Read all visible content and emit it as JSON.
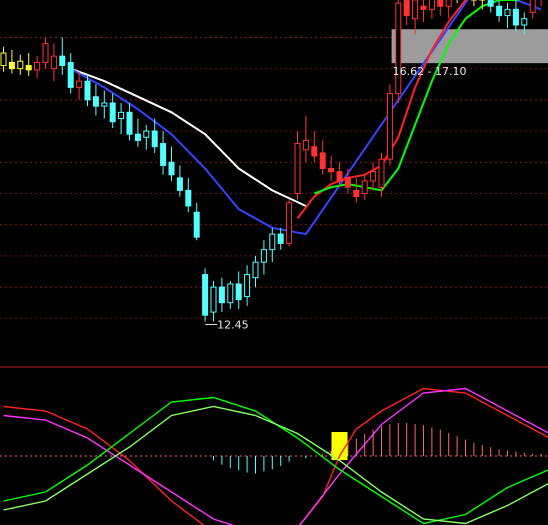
{
  "chart_data": [
    {
      "type": "candlestick",
      "panel": "price",
      "grid": "dotted horizontal red lines",
      "ylim": [
        11.8,
        17.6
      ],
      "annotations": [
        {
          "label": "12.45",
          "type": "low-marker",
          "value": 12.45
        },
        {
          "label": "16.62 - 17.10",
          "type": "price-band",
          "low": 16.62,
          "high": 17.1
        }
      ],
      "candles": [
        {
          "o": 16.55,
          "h": 16.85,
          "l": 16.45,
          "c": 16.75,
          "color": "#ffff33"
        },
        {
          "o": 16.6,
          "h": 16.8,
          "l": 16.42,
          "c": 16.5,
          "color": "#ffff33"
        },
        {
          "o": 16.5,
          "h": 16.72,
          "l": 16.4,
          "c": 16.62,
          "color": "#ffff33"
        },
        {
          "o": 16.55,
          "h": 16.75,
          "l": 16.38,
          "c": 16.48,
          "color": "#ffff33"
        },
        {
          "o": 16.48,
          "h": 16.7,
          "l": 16.35,
          "c": 16.6,
          "color": "#ff3333"
        },
        {
          "o": 16.6,
          "h": 17.0,
          "l": 16.5,
          "c": 16.9,
          "color": "#ff3333"
        },
        {
          "o": 16.5,
          "h": 16.9,
          "l": 16.3,
          "c": 16.7,
          "color": "#ff3333"
        },
        {
          "o": 16.7,
          "h": 17.0,
          "l": 16.4,
          "c": 16.55,
          "color": "#54ffff"
        },
        {
          "o": 16.6,
          "h": 16.75,
          "l": 16.1,
          "c": 16.2,
          "color": "#54ffff"
        },
        {
          "o": 16.2,
          "h": 16.45,
          "l": 16.0,
          "c": 16.3,
          "color": "#ff3333"
        },
        {
          "o": 16.3,
          "h": 16.4,
          "l": 15.9,
          "c": 16.0,
          "color": "#54ffff"
        },
        {
          "o": 16.05,
          "h": 16.25,
          "l": 15.75,
          "c": 15.9,
          "color": "#54ffff"
        },
        {
          "o": 15.9,
          "h": 16.15,
          "l": 15.7,
          "c": 15.95,
          "color": "#54ffff"
        },
        {
          "o": 15.95,
          "h": 16.1,
          "l": 15.55,
          "c": 15.65,
          "color": "#54ffff"
        },
        {
          "o": 15.7,
          "h": 15.95,
          "l": 15.45,
          "c": 15.8,
          "color": "#54ffff"
        },
        {
          "o": 15.8,
          "h": 15.95,
          "l": 15.35,
          "c": 15.45,
          "color": "#54ffff"
        },
        {
          "o": 15.45,
          "h": 15.7,
          "l": 15.25,
          "c": 15.35,
          "color": "#54ffff"
        },
        {
          "o": 15.4,
          "h": 15.6,
          "l": 15.2,
          "c": 15.5,
          "color": "#54ffff"
        },
        {
          "o": 15.5,
          "h": 15.7,
          "l": 15.15,
          "c": 15.25,
          "color": "#54ffff"
        },
        {
          "o": 15.3,
          "h": 15.5,
          "l": 14.8,
          "c": 14.95,
          "color": "#54ffff"
        },
        {
          "o": 15.0,
          "h": 15.25,
          "l": 14.7,
          "c": 14.8,
          "color": "#54ffff"
        },
        {
          "o": 14.75,
          "h": 14.95,
          "l": 14.45,
          "c": 14.55,
          "color": "#54ffff"
        },
        {
          "o": 14.55,
          "h": 14.75,
          "l": 14.2,
          "c": 14.3,
          "color": "#54ffff"
        },
        {
          "o": 14.2,
          "h": 14.35,
          "l": 13.75,
          "c": 13.8,
          "color": "#54ffff"
        },
        {
          "o": 13.2,
          "h": 13.3,
          "l": 12.45,
          "c": 12.55,
          "color": "#54ffff"
        },
        {
          "o": 12.6,
          "h": 13.1,
          "l": 12.45,
          "c": 13.0,
          "color": "#54ffff"
        },
        {
          "o": 13.0,
          "h": 13.15,
          "l": 12.6,
          "c": 12.75,
          "color": "#54ffff"
        },
        {
          "o": 12.75,
          "h": 13.1,
          "l": 12.65,
          "c": 13.05,
          "color": "#54ffff"
        },
        {
          "o": 13.05,
          "h": 13.25,
          "l": 12.65,
          "c": 12.8,
          "color": "#54ffff"
        },
        {
          "o": 12.85,
          "h": 13.35,
          "l": 12.7,
          "c": 13.2,
          "color": "#54ffff"
        },
        {
          "o": 13.15,
          "h": 13.5,
          "l": 13.0,
          "c": 13.4,
          "color": "#54ffff"
        },
        {
          "o": 13.4,
          "h": 13.75,
          "l": 13.2,
          "c": 13.6,
          "color": "#54ffff"
        },
        {
          "o": 13.6,
          "h": 13.95,
          "l": 13.4,
          "c": 13.85,
          "color": "#54ffff"
        },
        {
          "o": 13.85,
          "h": 13.95,
          "l": 13.6,
          "c": 13.7,
          "color": "#54ffff"
        },
        {
          "o": 13.7,
          "h": 14.4,
          "l": 13.65,
          "c": 14.35,
          "color": "#ff3333"
        },
        {
          "o": 14.5,
          "h": 15.5,
          "l": 14.4,
          "c": 15.3,
          "color": "#ff3333"
        },
        {
          "o": 15.2,
          "h": 15.75,
          "l": 15.0,
          "c": 15.35,
          "color": "#ff3333"
        },
        {
          "o": 15.25,
          "h": 15.5,
          "l": 15.0,
          "c": 15.1,
          "color": "#ff3333"
        },
        {
          "o": 15.15,
          "h": 15.35,
          "l": 14.8,
          "c": 14.9,
          "color": "#ff3333"
        },
        {
          "o": 14.9,
          "h": 15.1,
          "l": 14.7,
          "c": 14.85,
          "color": "#ff3333"
        },
        {
          "o": 14.85,
          "h": 15.0,
          "l": 14.6,
          "c": 14.7,
          "color": "#ff3333"
        },
        {
          "o": 14.75,
          "h": 14.9,
          "l": 14.5,
          "c": 14.6,
          "color": "#ff3333"
        },
        {
          "o": 14.55,
          "h": 14.75,
          "l": 14.35,
          "c": 14.45,
          "color": "#ff3333"
        },
        {
          "o": 14.5,
          "h": 14.8,
          "l": 14.4,
          "c": 14.7,
          "color": "#ff3333"
        },
        {
          "o": 14.7,
          "h": 15.0,
          "l": 14.55,
          "c": 14.85,
          "color": "#ff3333"
        },
        {
          "o": 14.6,
          "h": 15.15,
          "l": 14.45,
          "c": 15.05,
          "color": "#ff3333"
        },
        {
          "o": 15.05,
          "h": 16.25,
          "l": 14.95,
          "c": 16.1,
          "color": "#ff3333"
        },
        {
          "o": 16.1,
          "h": 17.7,
          "l": 15.95,
          "c": 17.55,
          "color": "#ff3333"
        },
        {
          "o": 17.6,
          "h": 17.9,
          "l": 17.2,
          "c": 17.35,
          "color": "#ff3333"
        },
        {
          "o": 17.3,
          "h": 17.7,
          "l": 17.05,
          "c": 17.6,
          "color": "#ff3333"
        },
        {
          "o": 17.5,
          "h": 17.8,
          "l": 17.25,
          "c": 17.45,
          "color": "#ff3333"
        },
        {
          "o": 17.45,
          "h": 17.75,
          "l": 17.3,
          "c": 17.65,
          "color": "#ff3333"
        },
        {
          "o": 17.6,
          "h": 17.85,
          "l": 17.35,
          "c": 17.5,
          "color": "#ff3333"
        },
        {
          "o": 17.5,
          "h": 17.8,
          "l": 17.3,
          "c": 17.7,
          "color": "#ff3333"
        },
        {
          "o": 17.7,
          "h": 17.95,
          "l": 17.55,
          "c": 17.85,
          "color": "#ffff33"
        },
        {
          "o": 17.85,
          "h": 17.95,
          "l": 17.6,
          "c": 17.7,
          "color": "#ffff33"
        },
        {
          "o": 17.7,
          "h": 17.9,
          "l": 17.5,
          "c": 17.6,
          "color": "#ffff33"
        },
        {
          "o": 17.6,
          "h": 17.85,
          "l": 17.45,
          "c": 17.75,
          "color": "#ffff33"
        },
        {
          "o": 17.75,
          "h": 17.85,
          "l": 17.4,
          "c": 17.5,
          "color": "#54ffff"
        },
        {
          "o": 17.5,
          "h": 17.65,
          "l": 17.25,
          "c": 17.35,
          "color": "#54ffff"
        },
        {
          "o": 17.35,
          "h": 17.55,
          "l": 17.15,
          "c": 17.45,
          "color": "#54ffff"
        },
        {
          "o": 17.45,
          "h": 17.6,
          "l": 17.1,
          "c": 17.2,
          "color": "#54ffff"
        },
        {
          "o": 17.2,
          "h": 17.4,
          "l": 17.05,
          "c": 17.3,
          "color": "#54ffff"
        },
        {
          "o": 17.4,
          "h": 17.75,
          "l": 17.3,
          "c": 17.65,
          "color": "#ff3333"
        },
        {
          "o": 17.65,
          "h": 17.95,
          "l": 17.5,
          "c": 17.8,
          "color": "#ff3333"
        },
        {
          "o": 17.8,
          "h": 17.95,
          "l": 17.65,
          "c": 17.9,
          "color": "#ffff33"
        }
      ],
      "series": [
        {
          "color": "#ffffff",
          "x": [
            8,
            12,
            16,
            20,
            24,
            28,
            32,
            36
          ],
          "values": [
            16.5,
            16.3,
            16.05,
            15.8,
            15.45,
            14.9,
            14.55,
            14.3
          ]
        },
        {
          "color": "#3344ff",
          "x": [
            8,
            12,
            16,
            20,
            24,
            28,
            32,
            36,
            56,
            58,
            60,
            62,
            64
          ],
          "values": [
            16.5,
            16.2,
            15.85,
            15.45,
            14.9,
            14.25,
            13.95,
            13.85,
            17.75,
            17.72,
            17.65,
            17.55,
            17.45
          ]
        },
        {
          "color": "#ff2222",
          "x": [
            35,
            37,
            39,
            41,
            43,
            45,
            47,
            49,
            51,
            53,
            55,
            57,
            59,
            61,
            63,
            65
          ],
          "values": [
            14.1,
            14.45,
            14.65,
            14.75,
            14.8,
            14.95,
            15.4,
            16.2,
            16.8,
            17.25,
            17.6,
            17.85,
            17.95,
            17.95,
            17.9,
            17.95
          ]
        },
        {
          "color": "#00ff00",
          "x": [
            37,
            39,
            41,
            43,
            45,
            47,
            49,
            51,
            53,
            55,
            57,
            59,
            61,
            63,
            65
          ],
          "values": [
            14.5,
            14.6,
            14.65,
            14.6,
            14.55,
            14.9,
            15.6,
            16.3,
            16.9,
            17.3,
            17.5,
            17.6,
            17.6,
            17.65,
            17.75
          ]
        }
      ]
    },
    {
      "type": "line",
      "panel": "indicator",
      "grid": "dotted zero line",
      "ylim": [
        -1,
        1
      ],
      "highlight": {
        "x": 40,
        "color": "#ffff00"
      },
      "histogram": {
        "x": [
          25,
          26,
          27,
          28,
          29,
          30,
          31,
          32,
          33,
          34,
          36,
          37,
          38,
          39,
          40,
          41,
          42,
          43,
          44,
          45,
          46,
          47,
          48,
          49,
          50,
          51,
          52,
          53,
          54,
          55,
          56,
          57,
          58,
          59,
          60,
          61,
          62,
          63,
          64,
          65
        ],
        "values": [
          -0.04,
          -0.08,
          -0.11,
          -0.13,
          -0.15,
          -0.16,
          -0.14,
          -0.12,
          -0.09,
          -0.05,
          -0.02,
          0.0,
          0.02,
          0.05,
          0.08,
          0.12,
          0.16,
          0.2,
          0.24,
          0.27,
          0.29,
          0.3,
          0.3,
          0.29,
          0.28,
          0.26,
          0.24,
          0.21,
          0.18,
          0.15,
          0.12,
          0.1,
          0.08,
          0.06,
          0.05,
          0.04,
          0.03,
          0.02,
          0.02,
          0.01
        ],
        "colors": [
          "#54ffff",
          "#ff6666"
        ]
      },
      "series": [
        {
          "color": "#ff2222",
          "x": [
            0,
            5,
            10,
            15,
            20,
            25,
            30,
            35,
            38,
            40,
            42,
            45,
            50,
            55,
            60,
            65
          ],
          "values": [
            0.55,
            0.5,
            0.3,
            -0.05,
            -0.5,
            -0.85,
            -0.95,
            -0.8,
            -0.45,
            0.0,
            0.3,
            0.5,
            0.75,
            0.7,
            0.45,
            0.2
          ]
        },
        {
          "color": "#ff33ff",
          "x": [
            0,
            5,
            10,
            15,
            20,
            25,
            30,
            35,
            40,
            45,
            50,
            55,
            60,
            65
          ],
          "values": [
            0.45,
            0.4,
            0.2,
            -0.1,
            -0.4,
            -0.7,
            -0.85,
            -0.8,
            -0.2,
            0.35,
            0.7,
            0.75,
            0.5,
            0.25
          ]
        },
        {
          "color": "#00ff00",
          "x": [
            0,
            5,
            10,
            15,
            20,
            25,
            30,
            35,
            40,
            45,
            50,
            55,
            60,
            65
          ],
          "values": [
            -0.5,
            -0.4,
            -0.1,
            0.25,
            0.6,
            0.65,
            0.5,
            0.2,
            -0.15,
            -0.45,
            -0.75,
            -0.65,
            -0.35,
            -0.15
          ]
        },
        {
          "color": "#88ff66",
          "x": [
            0,
            5,
            10,
            15,
            20,
            25,
            30,
            35,
            40,
            45,
            50,
            55,
            60,
            65
          ],
          "values": [
            -0.6,
            -0.5,
            -0.2,
            0.1,
            0.45,
            0.55,
            0.45,
            0.25,
            -0.05,
            -0.4,
            -0.7,
            -0.75,
            -0.55,
            -0.3
          ]
        }
      ]
    }
  ]
}
